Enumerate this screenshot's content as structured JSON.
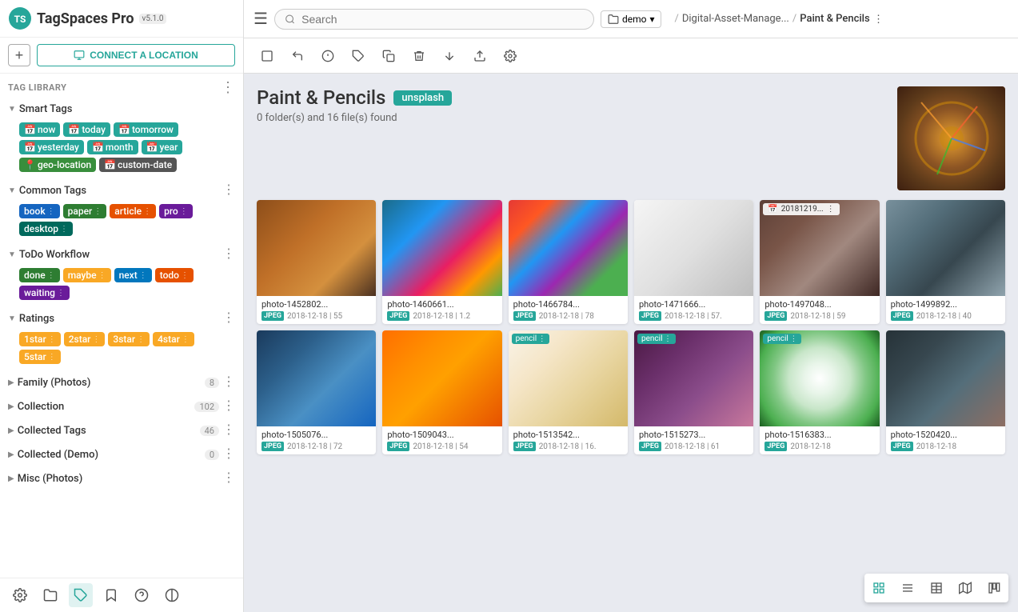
{
  "app": {
    "name": "TagSpaces Pro",
    "version": "v5.1.0"
  },
  "sidebar": {
    "connect_button": "CONNECT A LOCATION",
    "tag_library_title": "TAG LIBRARY",
    "sections": {
      "smart_tags": {
        "title": "Smart Tags",
        "tags": [
          "now",
          "today",
          "tomorrow",
          "yesterday",
          "month",
          "year",
          "geo-location",
          "custom-date"
        ]
      },
      "common_tags": {
        "title": "Common Tags",
        "tags": [
          "book",
          "paper",
          "article",
          "pro",
          "desktop"
        ]
      },
      "todo_workflow": {
        "title": "ToDo Workflow",
        "tags": [
          "done",
          "maybe",
          "next",
          "todo",
          "waiting"
        ]
      },
      "ratings": {
        "title": "Ratings",
        "tags": [
          "1star",
          "2star",
          "3star",
          "4star",
          "5star"
        ]
      },
      "family_photos": {
        "title": "Family (Photos)",
        "count": "8"
      },
      "collection": {
        "title": "Collection",
        "count": "102"
      },
      "collected_tags": {
        "title": "Collected Tags",
        "count": "46"
      },
      "collected_demo": {
        "title": "Collected (Demo)",
        "count": "0"
      },
      "misc_photos": {
        "title": "Misc (Photos)"
      }
    },
    "footer_icons": [
      "settings",
      "folder",
      "tag",
      "bookmark",
      "help",
      "contrast"
    ]
  },
  "topbar": {
    "search_placeholder": "Search",
    "location": "demo",
    "breadcrumb1": "Digital-Asset-Manage...",
    "breadcrumb2": "Paint & Pencils"
  },
  "gallery": {
    "title": "Paint & Pencils",
    "badge": "unsplash",
    "subtitle": "0 folder(s) and 16 file(s) found",
    "files": [
      {
        "name": "photo-1452802...",
        "type": "JPEG",
        "date": "2018-12-18",
        "size": "55",
        "thumb_class": "thumb-1",
        "tags": []
      },
      {
        "name": "photo-1460661...",
        "type": "JPEG",
        "date": "2018-12-18",
        "size": "1.2",
        "thumb_class": "thumb-2",
        "tags": []
      },
      {
        "name": "photo-1466784...",
        "type": "JPEG",
        "date": "2018-12-18",
        "size": "78",
        "thumb_class": "thumb-3",
        "tags": []
      },
      {
        "name": "photo-1471666...",
        "type": "JPEG",
        "date": "2018-12-18",
        "size": "57.",
        "thumb_class": "thumb-4",
        "tags": []
      },
      {
        "name": "photo-1497048...",
        "type": "JPEG",
        "date": "2018-12-18",
        "size": "59",
        "thumb_class": "thumb-5",
        "tags": [],
        "date_overlay": "20181219..."
      },
      {
        "name": "photo-1499892...",
        "type": "JPEG",
        "date": "2018-12-18",
        "size": "40",
        "thumb_class": "thumb-6",
        "tags": []
      },
      {
        "name": "photo-1505076...",
        "type": "JPEG",
        "date": "2018-12-18",
        "size": "72",
        "thumb_class": "thumb-7",
        "tags": []
      },
      {
        "name": "photo-1509043...",
        "type": "JPEG",
        "date": "2018-12-18",
        "size": "54",
        "thumb_class": "thumb-8",
        "tags": []
      },
      {
        "name": "photo-1513542...",
        "type": "JPEG",
        "date": "2018-12-18",
        "size": "16.",
        "thumb_class": "thumb-9",
        "tags": [
          "pencil"
        ]
      },
      {
        "name": "photo-1515273...",
        "type": "JPEG",
        "date": "2018-12-18",
        "size": "61",
        "thumb_class": "thumb-10",
        "tags": [
          "pencil"
        ]
      },
      {
        "name": "photo-1516383...",
        "type": "JPEG",
        "date": "2018-12-18",
        "size": "",
        "thumb_class": "thumb-11",
        "tags": [
          "pencil"
        ]
      },
      {
        "name": "photo-1520420...",
        "type": "JPEG",
        "date": "2018-12-18",
        "size": "",
        "thumb_class": "thumb-12",
        "tags": []
      }
    ]
  },
  "toolbar": {
    "buttons": [
      "select-all",
      "go-back",
      "info",
      "tag",
      "copy",
      "delete",
      "sort",
      "add-file",
      "settings"
    ]
  }
}
